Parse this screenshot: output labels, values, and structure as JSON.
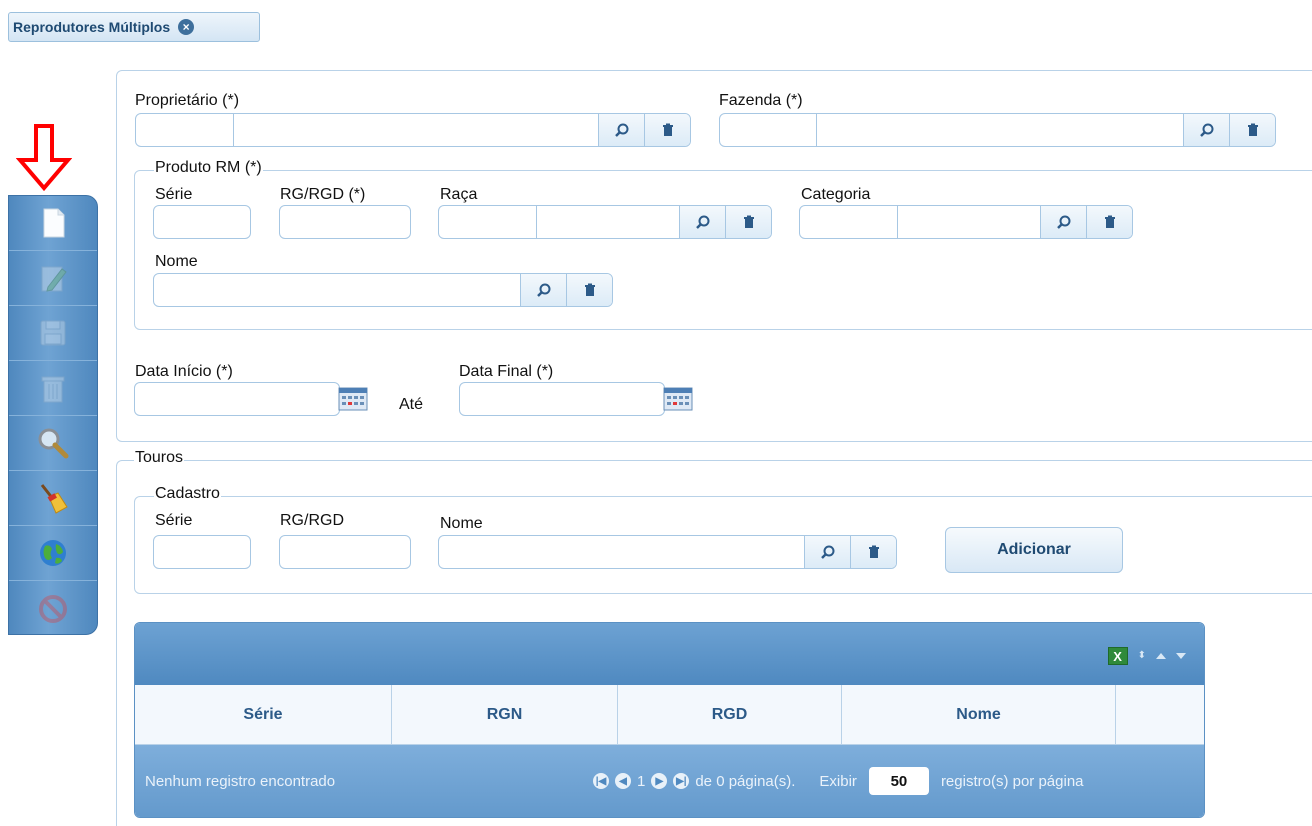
{
  "tab": {
    "title": "Reprodutores Múltiplos",
    "close_icon": "close-icon"
  },
  "toolbar": {
    "items": [
      {
        "name": "new",
        "icon": "new-document-icon",
        "enabled": true
      },
      {
        "name": "edit",
        "icon": "edit-icon",
        "enabled": false
      },
      {
        "name": "save",
        "icon": "save-icon",
        "enabled": false
      },
      {
        "name": "delete",
        "icon": "delete-icon",
        "enabled": false
      },
      {
        "name": "search",
        "icon": "search-icon",
        "enabled": true
      },
      {
        "name": "clear",
        "icon": "broom-icon",
        "enabled": true
      },
      {
        "name": "web",
        "icon": "globe-icon",
        "enabled": true
      },
      {
        "name": "cancel",
        "icon": "cancel-icon",
        "enabled": false
      }
    ]
  },
  "form": {
    "proprietario_label": "Proprietário (*)",
    "fazenda_label": "Fazenda (*)",
    "produto_legend": "Produto RM (*)",
    "serie_label": "Série",
    "rgrgd_required_label": "RG/RGD (*)",
    "raca_label": "Raça",
    "categoria_label": "Categoria",
    "nome_label": "Nome",
    "data_inicio_label": "Data Início (*)",
    "ate_label": "Até",
    "data_final_label": "Data Final (*)"
  },
  "touros": {
    "legend": "Touros",
    "cadastro_legend": "Cadastro",
    "serie_label": "Série",
    "rgrgd_label": "RG/RGD",
    "nome_label": "Nome",
    "add_button": "Adicionar"
  },
  "grid": {
    "columns": [
      "Série",
      "RGN",
      "RGD",
      "Nome"
    ],
    "empty_message": "Nenhum registro encontrado",
    "current_page": "1",
    "page_info": "de 0 página(s).",
    "show_label": "Exibir",
    "per_page": "50",
    "per_page_suffix": "registro(s) por página"
  }
}
